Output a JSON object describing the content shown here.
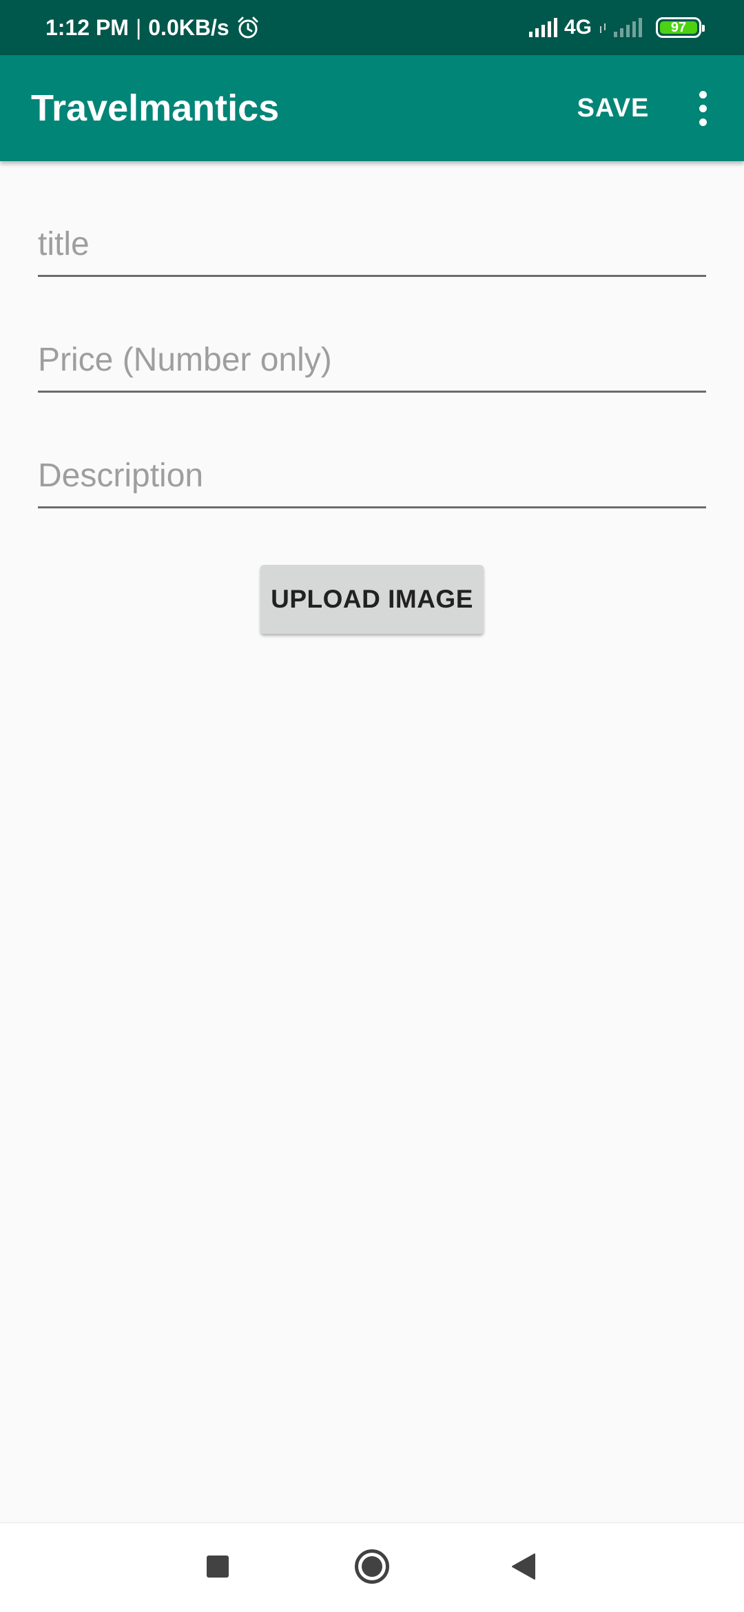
{
  "status_bar": {
    "time": "1:12 PM",
    "separator": "|",
    "speed": "0.0KB/s",
    "network": "4G",
    "battery": "97",
    "icons": [
      "alarm-icon",
      "signal-icon",
      "signal-off-icon",
      "battery-icon"
    ]
  },
  "app_bar": {
    "title": "Travelmantics",
    "save_label": "SAVE",
    "overflow_icon": "more-vert-icon",
    "color": "#008577",
    "status_color": "#00574b"
  },
  "form": {
    "title_placeholder": "title",
    "price_placeholder": "Price (Number only)",
    "description_placeholder": "Description",
    "upload_label": "UPLOAD IMAGE"
  },
  "nav_bar": {
    "icons": [
      "recent-apps-icon",
      "home-icon",
      "back-icon"
    ]
  }
}
